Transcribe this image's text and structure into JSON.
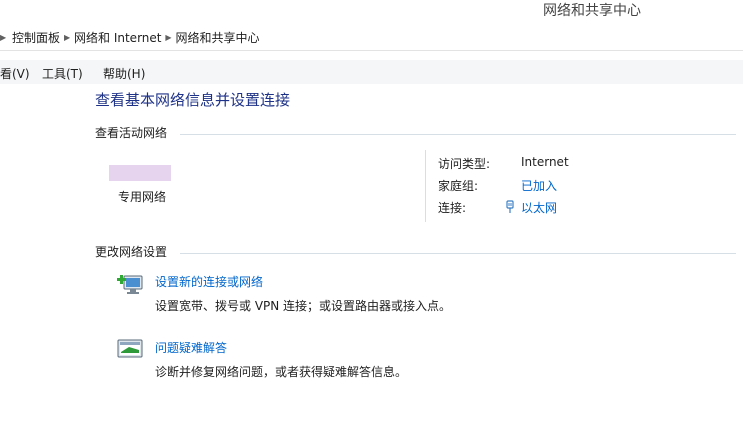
{
  "window": {
    "title": "网络和共享中心"
  },
  "breadcrumb": {
    "items": [
      "控制面板",
      "网络和 Internet",
      "网络和共享中心"
    ]
  },
  "menu": {
    "items": [
      "看(V)",
      "工具(T)",
      "帮助(H)"
    ]
  },
  "main": {
    "heading": "查看基本网络信息并设置连接",
    "active_networks": {
      "section_title": "查看活动网络",
      "network_name": "专用网络",
      "access_type_label": "访问类型:",
      "access_type_value": "Internet",
      "homegroup_label": "家庭组:",
      "homegroup_value": "已加入",
      "connection_label": "连接:",
      "connection_value": "以太网"
    },
    "change_settings": {
      "section_title": "更改网络设置",
      "tasks": [
        {
          "link": "设置新的连接或网络",
          "description": "设置宽带、拨号或 VPN 连接；或设置路由器或接入点。",
          "icon": "new-connection-icon"
        },
        {
          "link": "问题疑难解答",
          "description": "诊断并修复网络问题，或者获得疑难解答信息。",
          "icon": "troubleshoot-icon"
        }
      ]
    }
  },
  "colors": {
    "heading": "#1e3287",
    "link": "#0066cc",
    "menubar_bg": "#f5f6f7",
    "divider": "#d5dfe5",
    "network_thumb": "#e6d4ee"
  }
}
